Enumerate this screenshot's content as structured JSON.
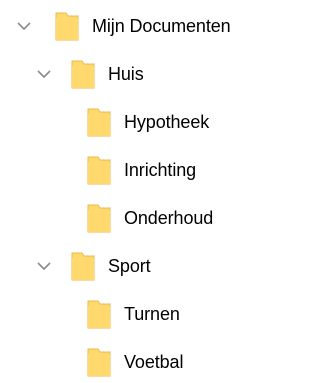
{
  "tree": {
    "root": {
      "label": "Mijn Documenten",
      "expanded": true,
      "icon": "folder-icon",
      "children": [
        {
          "label": "Huis",
          "expanded": true,
          "icon": "folder-icon",
          "children": [
            {
              "label": "Hypotheek",
              "icon": "folder-icon"
            },
            {
              "label": "Inrichting",
              "icon": "folder-icon"
            },
            {
              "label": "Onderhoud",
              "icon": "folder-icon"
            }
          ]
        },
        {
          "label": "Sport",
          "expanded": true,
          "icon": "folder-icon",
          "children": [
            {
              "label": "Turnen",
              "icon": "folder-icon"
            },
            {
              "label": "Voetbal",
              "icon": "folder-icon"
            }
          ]
        }
      ]
    }
  },
  "colors": {
    "folder_fill": "#FFD86E",
    "folder_edge": "#E9B84A",
    "chevron": "#8A8A8A",
    "text": "#000000"
  }
}
